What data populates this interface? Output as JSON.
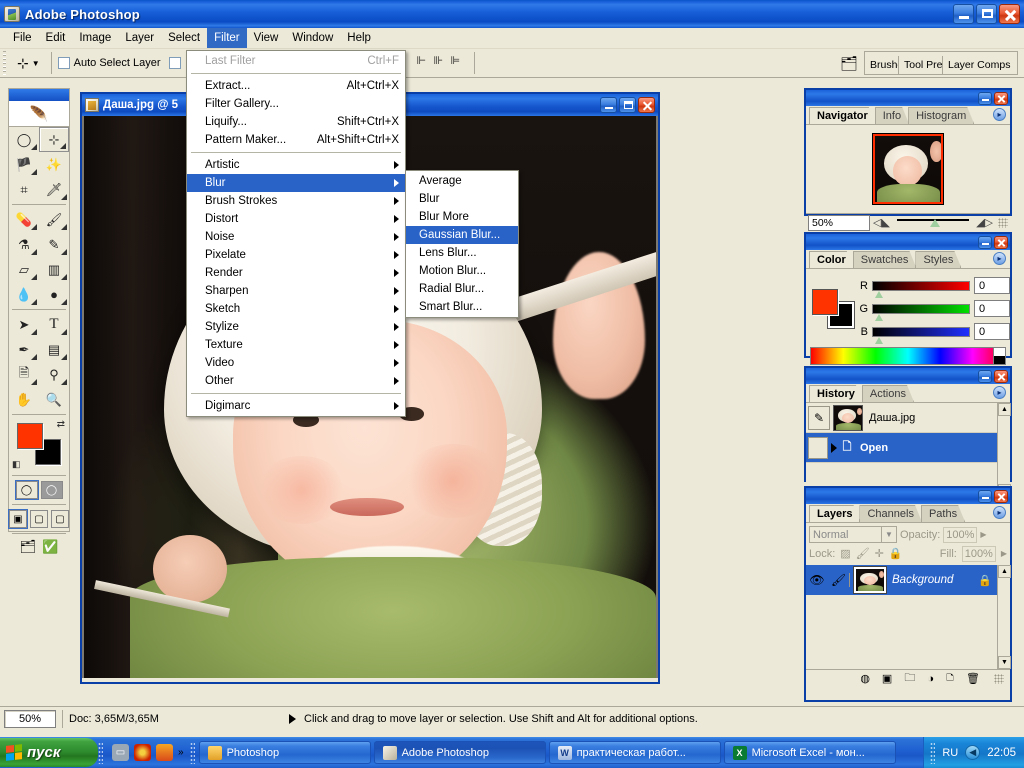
{
  "app": {
    "title": "Adobe Photoshop",
    "icon": "photoshop-icon"
  },
  "window_buttons": {
    "minimize": "_",
    "restore": "□",
    "close": "✕"
  },
  "menubar": {
    "items": [
      {
        "label": "File",
        "active": false
      },
      {
        "label": "Edit",
        "active": false
      },
      {
        "label": "Image",
        "active": false
      },
      {
        "label": "Layer",
        "active": false
      },
      {
        "label": "Select",
        "active": false
      },
      {
        "label": "Filter",
        "active": true
      },
      {
        "label": "View",
        "active": false
      },
      {
        "label": "Window",
        "active": false
      },
      {
        "label": "Help",
        "active": false
      }
    ]
  },
  "options_bar": {
    "tool_icon": "move-tool-icon",
    "auto_select_layer": "Auto Select Layer",
    "show_bounding_box": "",
    "palette_well": [
      "Brushes",
      "Tool Presets",
      "Layer Comps"
    ]
  },
  "filter_menu": {
    "items": [
      {
        "label": "Last Filter",
        "accel": "Ctrl+F",
        "disabled": true,
        "submenu": false,
        "selected": false
      },
      {
        "sep": true
      },
      {
        "label": "Extract...",
        "accel": "Alt+Ctrl+X",
        "disabled": false,
        "submenu": false,
        "selected": false
      },
      {
        "label": "Filter Gallery...",
        "accel": "",
        "disabled": false,
        "submenu": false,
        "selected": false
      },
      {
        "label": "Liquify...",
        "accel": "Shift+Ctrl+X",
        "disabled": false,
        "submenu": false,
        "selected": false
      },
      {
        "label": "Pattern Maker...",
        "accel": "Alt+Shift+Ctrl+X",
        "disabled": false,
        "submenu": false,
        "selected": false
      },
      {
        "sep": true
      },
      {
        "label": "Artistic",
        "accel": "",
        "disabled": false,
        "submenu": true,
        "selected": false
      },
      {
        "label": "Blur",
        "accel": "",
        "disabled": false,
        "submenu": true,
        "selected": true
      },
      {
        "label": "Brush Strokes",
        "accel": "",
        "disabled": false,
        "submenu": true,
        "selected": false
      },
      {
        "label": "Distort",
        "accel": "",
        "disabled": false,
        "submenu": true,
        "selected": false
      },
      {
        "label": "Noise",
        "accel": "",
        "disabled": false,
        "submenu": true,
        "selected": false
      },
      {
        "label": "Pixelate",
        "accel": "",
        "disabled": false,
        "submenu": true,
        "selected": false
      },
      {
        "label": "Render",
        "accel": "",
        "disabled": false,
        "submenu": true,
        "selected": false
      },
      {
        "label": "Sharpen",
        "accel": "",
        "disabled": false,
        "submenu": true,
        "selected": false
      },
      {
        "label": "Sketch",
        "accel": "",
        "disabled": false,
        "submenu": true,
        "selected": false
      },
      {
        "label": "Stylize",
        "accel": "",
        "disabled": false,
        "submenu": true,
        "selected": false
      },
      {
        "label": "Texture",
        "accel": "",
        "disabled": false,
        "submenu": true,
        "selected": false
      },
      {
        "label": "Video",
        "accel": "",
        "disabled": false,
        "submenu": true,
        "selected": false
      },
      {
        "label": "Other",
        "accel": "",
        "disabled": false,
        "submenu": true,
        "selected": false
      },
      {
        "sep": true
      },
      {
        "label": "Digimarc",
        "accel": "",
        "disabled": false,
        "submenu": true,
        "selected": false
      }
    ]
  },
  "blur_submenu": {
    "items": [
      {
        "label": "Average",
        "selected": false
      },
      {
        "label": "Blur",
        "selected": false
      },
      {
        "label": "Blur More",
        "selected": false
      },
      {
        "label": "Gaussian Blur...",
        "selected": true
      },
      {
        "label": "Lens Blur...",
        "selected": false
      },
      {
        "label": "Motion Blur...",
        "selected": false
      },
      {
        "label": "Radial Blur...",
        "selected": false
      },
      {
        "label": "Smart Blur...",
        "selected": false
      }
    ]
  },
  "toolbox": {
    "tools": [
      {
        "name": "marquee-tool",
        "glyph": "◯",
        "selected": false
      },
      {
        "name": "move-tool",
        "glyph": "➤",
        "selected": true
      },
      {
        "name": "lasso-tool",
        "glyph": "🖉",
        "selected": false
      },
      {
        "name": "magic-wand-tool",
        "glyph": "✳",
        "selected": false
      },
      {
        "name": "crop-tool",
        "glyph": "⌗",
        "selected": false
      },
      {
        "name": "slice-tool",
        "glyph": "⟋",
        "selected": false
      },
      {
        "name": "healing-brush-tool",
        "glyph": "✒",
        "selected": false
      },
      {
        "name": "brush-tool",
        "glyph": "🖌",
        "selected": false
      },
      {
        "name": "clone-stamp-tool",
        "glyph": "⚐",
        "selected": false
      },
      {
        "name": "history-brush-tool",
        "glyph": "✎",
        "selected": false
      },
      {
        "name": "eraser-tool",
        "glyph": "▭",
        "selected": false
      },
      {
        "name": "gradient-tool",
        "glyph": "▦",
        "selected": false
      },
      {
        "name": "blur-tool",
        "glyph": "💧",
        "selected": false
      },
      {
        "name": "dodge-tool",
        "glyph": "●",
        "selected": false
      },
      {
        "name": "path-selection-tool",
        "glyph": "➤",
        "selected": false
      },
      {
        "name": "type-tool",
        "glyph": "T",
        "selected": false
      },
      {
        "name": "pen-tool",
        "glyph": "✑",
        "selected": false
      },
      {
        "name": "shape-tool",
        "glyph": "▬",
        "selected": false
      },
      {
        "name": "notes-tool",
        "glyph": "🗎",
        "selected": false
      },
      {
        "name": "eyedropper-tool",
        "glyph": "⚲",
        "selected": false
      },
      {
        "name": "hand-tool",
        "glyph": "✋",
        "selected": false
      },
      {
        "name": "zoom-tool",
        "glyph": "🔍",
        "selected": false
      }
    ],
    "foreground_color": "#ff3300",
    "background_color": "#000000",
    "swap_icon": "swap-colors-icon",
    "default_colors_icon": "default-colors-icon",
    "screen_modes": [
      "standard-screen-mode",
      "full-screen-with-menubar",
      "full-screen-mode"
    ],
    "edit_modes": [
      "standard-mode",
      "quick-mask-mode"
    ],
    "jump_to": [
      "jump-to-imageready-icon",
      "imageready-icon"
    ]
  },
  "document": {
    "title": "Даша.jpg @ 5",
    "title_icon": "document-icon"
  },
  "status_bar": {
    "zoom": "50%",
    "doc_info": "Doc: 3,65M/3,65M",
    "hint": "Click and drag to move layer or selection.  Use Shift and Alt for additional options."
  },
  "palettes": {
    "navigator": {
      "tabs": [
        {
          "label": "Navigator",
          "active": true
        },
        {
          "label": "Info",
          "active": false
        },
        {
          "label": "Histogram",
          "active": false
        }
      ],
      "zoom_value": "50%",
      "menu_icon": "palette-menu-icon",
      "thumbnail": "navigator-thumbnail",
      "zoom_out_icon": "zoom-out-icon",
      "zoom_in_icon": "zoom-in-icon"
    },
    "color": {
      "tabs": [
        {
          "label": "Color",
          "active": true
        },
        {
          "label": "Swatches",
          "active": false
        },
        {
          "label": "Styles",
          "active": false
        }
      ],
      "foreground": "#ff3300",
      "background": "#000000",
      "channels": [
        {
          "label": "R",
          "value": "0"
        },
        {
          "label": "G",
          "value": "0"
        },
        {
          "label": "B",
          "value": "0"
        }
      ],
      "menu_icon": "palette-menu-icon"
    },
    "history": {
      "tabs": [
        {
          "label": "History",
          "active": true
        },
        {
          "label": "Actions",
          "active": false
        }
      ],
      "source_name": "Даша.jpg",
      "states": [
        {
          "label": "Open",
          "selected": true
        }
      ],
      "footer_icons": [
        "new-document-from-state-icon",
        "new-snapshot-icon",
        "delete-state-icon"
      ],
      "menu_icon": "palette-menu-icon"
    },
    "layers": {
      "tabs": [
        {
          "label": "Layers",
          "active": true
        },
        {
          "label": "Channels",
          "active": false
        },
        {
          "label": "Paths",
          "active": false
        }
      ],
      "blend_mode": "Normal",
      "opacity_label": "Opacity:",
      "opacity_value": "100%",
      "lock_label": "Lock:",
      "lock_icons": [
        "lock-transparent-pixels-icon",
        "lock-image-pixels-icon",
        "lock-position-icon",
        "lock-all-icon"
      ],
      "fill_label": "Fill:",
      "fill_value": "100%",
      "items": [
        {
          "name": "Background",
          "visible": true,
          "locked": true,
          "selected": true
        }
      ],
      "footer_icons": [
        "link-layers-icon",
        "layer-style-icon",
        "layer-mask-icon",
        "new-fill-adjustment-icon",
        "new-group-icon",
        "new-layer-icon",
        "delete-layer-icon"
      ],
      "menu_icon": "palette-menu-icon"
    }
  },
  "taskbar": {
    "start_label": "пуск",
    "quick_launch": [
      "show-desktop-icon",
      "opera-icon",
      "media-player-icon",
      "more-icon"
    ],
    "tasks": [
      {
        "label": "Photoshop",
        "icon": "folder-icon",
        "active": false
      },
      {
        "label": "Adobe Photoshop",
        "icon": "photoshop-icon",
        "active": true
      },
      {
        "label": "практическая работ...",
        "icon": "word-icon",
        "active": false
      },
      {
        "label": "Microsoft Excel - мон...",
        "icon": "excel-icon",
        "active": false
      }
    ],
    "tray": {
      "language": "RU",
      "volume_icon": "volume-icon",
      "clock": "22:05"
    }
  },
  "colors": {
    "title_blue": "#1a62da",
    "menu_highlight": "#2a63c8",
    "panel_face": "#ece9d8",
    "accent_red": "#ff3300"
  }
}
